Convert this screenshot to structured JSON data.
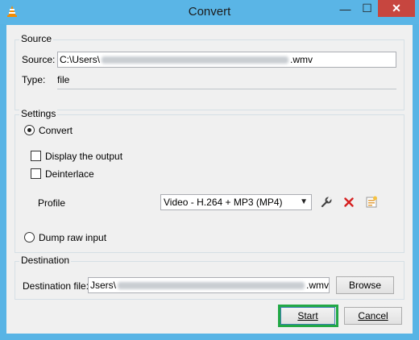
{
  "window": {
    "title": "Convert",
    "controls": {
      "minimize": "—",
      "maximize": "☐",
      "close": "✕"
    }
  },
  "source": {
    "group_label": "Source",
    "source_label": "Source:",
    "source_value_prefix": "C:\\Users\\",
    "source_value_suffix": ".wmv",
    "type_label": "Type:",
    "type_value": "file"
  },
  "settings": {
    "group_label": "Settings",
    "convert_label": "Convert",
    "convert_selected": true,
    "display_output_label": "Display the output",
    "display_output_checked": false,
    "deinterlace_label": "Deinterlace",
    "deinterlace_checked": false,
    "profile_label": "Profile",
    "profile_value": "Video - H.264 + MP3 (MP4)",
    "profile_icons": [
      "wrench-icon",
      "delete-icon",
      "new-profile-icon"
    ],
    "dump_raw_label": "Dump raw input",
    "dump_raw_selected": false
  },
  "destination": {
    "group_label": "Destination",
    "file_label": "Destination file:",
    "file_value_prefix": "Jsers\\",
    "file_value_suffix": ".wmv",
    "browse_label": "Browse"
  },
  "actions": {
    "start_label": "Start",
    "cancel_label": "Cancel"
  },
  "colors": {
    "titlebar": "#5ab5e6",
    "close_button": "#c7463f",
    "highlight": "#22a845",
    "delete_icon": "#d62020"
  }
}
